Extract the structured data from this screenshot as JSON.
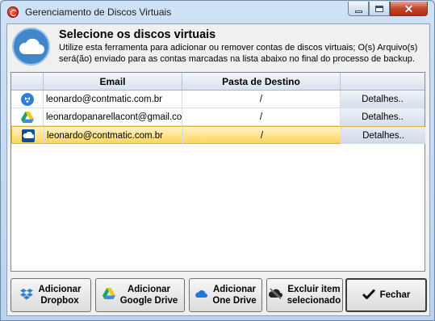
{
  "window": {
    "title": "Gerenciamento de Discos Virtuais",
    "close_glyph": "✕"
  },
  "header": {
    "title": "Selecione os discos virtuais",
    "description": "Utilize esta ferramenta para adicionar ou remover contas de discos virtuais; O(s) Arquivo(s) será(ão) enviado para as contas marcadas na lista abaixo no final do processo de backup."
  },
  "grid": {
    "columns": [
      "",
      "Email",
      "Pasta de Destino",
      ""
    ],
    "rows": [
      {
        "service_icon": "dropbox-icon",
        "email": "leonardo@contmatic.com.br",
        "pasta": "/",
        "detail_label": "Detalhes..",
        "selected": false
      },
      {
        "service_icon": "google-drive-icon",
        "email": "leonardopanarellacont@gmail.com",
        "pasta": "/",
        "detail_label": "Detalhes..",
        "selected": false
      },
      {
        "service_icon": "onedrive-icon",
        "email": "leonardo@contmatic.com.br",
        "pasta": "/",
        "detail_label": "Detalhes..",
        "selected": true
      }
    ]
  },
  "buttons": {
    "dropbox": {
      "line1": "Adicionar",
      "line2": "Dropbox",
      "icon": "dropbox-icon"
    },
    "gdrive": {
      "line1": "Adicionar",
      "line2": "Google Drive",
      "icon": "google-drive-icon"
    },
    "onedrive": {
      "line1": "Adicionar",
      "line2": "One Drive",
      "icon": "onedrive-icon"
    },
    "excluir": {
      "line1": "Excluir item",
      "line2": "selecionado",
      "icon": "cloud-delete-icon"
    },
    "fechar": {
      "label": "Fechar",
      "icon": "checkmark-icon"
    }
  },
  "colors": {
    "selection": "#fcd55d",
    "cloud_accent": "#3f87c9"
  }
}
